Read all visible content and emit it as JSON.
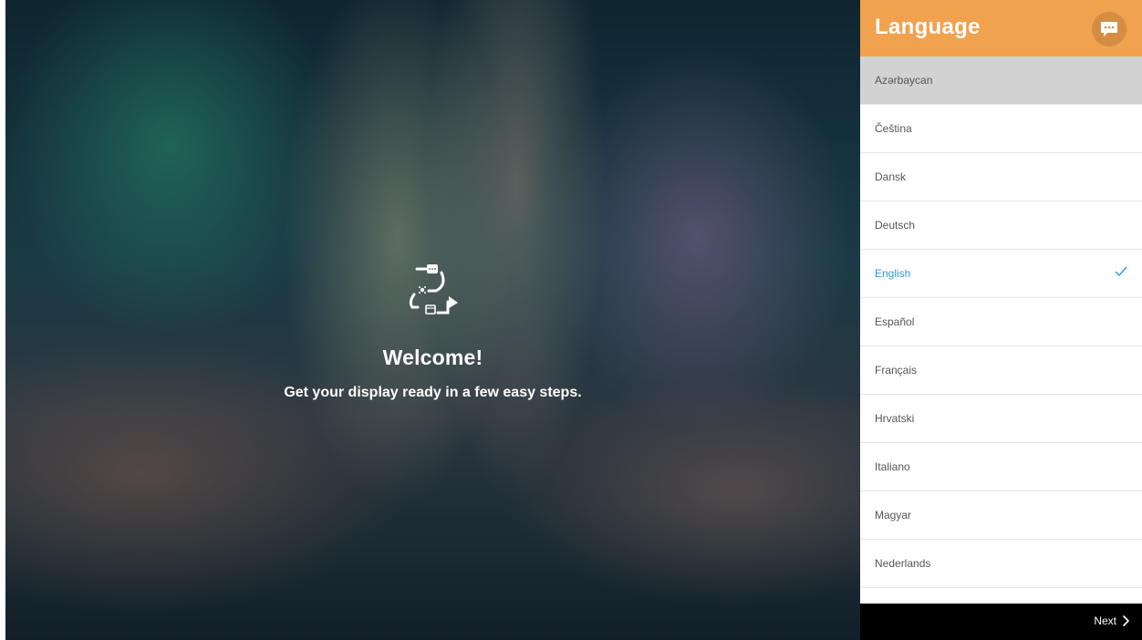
{
  "welcome": {
    "icon": "setup-steps-icon",
    "title": "Welcome!",
    "subtitle": "Get your display ready in a few easy steps."
  },
  "panel": {
    "title": "Language",
    "chat_icon": "chat-bubble-icon",
    "accent_color": "#f0a24e",
    "selected_color": "#2f9bd8",
    "languages": [
      {
        "label": "Azərbaycan",
        "highlighted": true
      },
      {
        "label": "Čeština"
      },
      {
        "label": "Dansk"
      },
      {
        "label": "Deutsch"
      },
      {
        "label": "English",
        "selected": true
      },
      {
        "label": "Español"
      },
      {
        "label": "Français"
      },
      {
        "label": "Hrvatski"
      },
      {
        "label": "Italiano"
      },
      {
        "label": "Magyar"
      },
      {
        "label": "Nederlands"
      }
    ],
    "next_label": "Next",
    "next_icon": "chevron-right-icon"
  }
}
